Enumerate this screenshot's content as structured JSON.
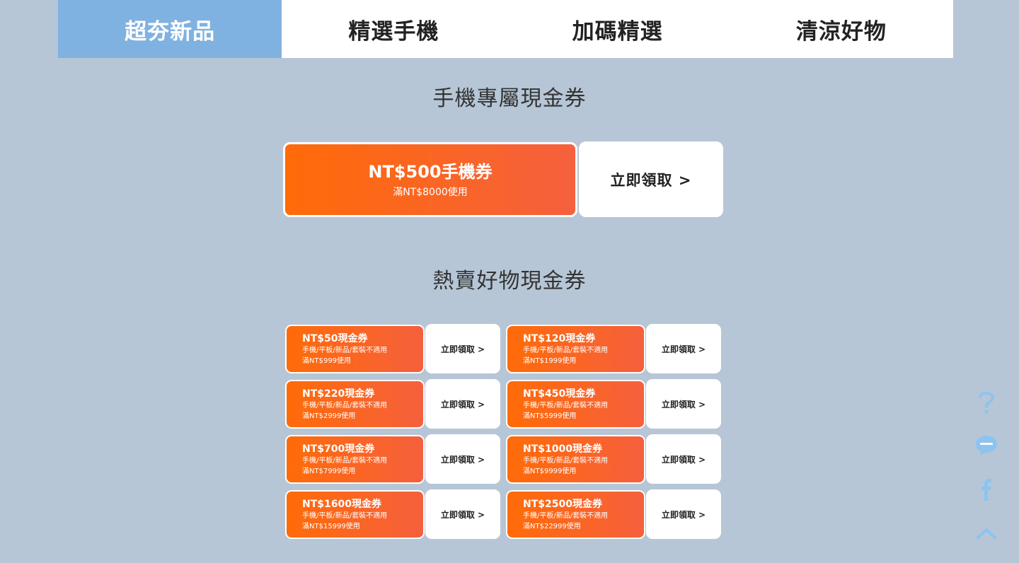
{
  "tabs": [
    {
      "label": "超夯新品",
      "active": true
    },
    {
      "label": "精選手機",
      "active": false
    },
    {
      "label": "加碼精選",
      "active": false
    },
    {
      "label": "清涼好物",
      "active": false
    }
  ],
  "sections": {
    "phone_title": "手機專屬現金券",
    "hot_title": "熱賣好物現金券"
  },
  "phone_coupon": {
    "amount": "NT$500手機券",
    "condition": "滿NT$8000使用",
    "claim_label": "立即領取 >"
  },
  "coupons": [
    {
      "amount": "NT$50現金券",
      "exclusion": "手機/平板/新品/套裝不適用",
      "condition": "滿NT$999使用",
      "claim_label": "立即領取 >"
    },
    {
      "amount": "NT$120現金券",
      "exclusion": "手機/平板/新品/套裝不適用",
      "condition": "滿NT$1999使用",
      "claim_label": "立即領取 >"
    },
    {
      "amount": "NT$220現金券",
      "exclusion": "手機/平板/新品/套裝不適用",
      "condition": "滿NT$2999使用",
      "claim_label": "立即領取 >"
    },
    {
      "amount": "NT$450現金券",
      "exclusion": "手機/平板/新品/套裝不適用",
      "condition": "滿NT$5999使用",
      "claim_label": "立即領取 >"
    },
    {
      "amount": "NT$700現金券",
      "exclusion": "手機/平板/新品/套裝不適用",
      "condition": "滿NT$7999使用",
      "claim_label": "立即領取 >"
    },
    {
      "amount": "NT$1000現金券",
      "exclusion": "手機/平板/新品/套裝不適用",
      "condition": "滿NT$9999使用",
      "claim_label": "立即領取 >"
    },
    {
      "amount": "NT$1600現金券",
      "exclusion": "手機/平板/新品/套裝不適用",
      "condition": "滿NT$15999使用",
      "claim_label": "立即領取 >"
    },
    {
      "amount": "NT$2500現金券",
      "exclusion": "手機/平板/新品/套裝不適用",
      "condition": "滿NT$22999使用",
      "claim_label": "立即領取 >"
    }
  ],
  "floating_buttons": [
    "question-icon",
    "line-chat-icon",
    "facebook-icon",
    "back-to-top-icon"
  ],
  "colors": {
    "background": "#b6c6d6",
    "active_tab": "#7fb2e0",
    "coupon_orange": "#ff6b08",
    "coupon_orange_end": "#f5603e",
    "float_icon": "#8cc4f0"
  }
}
